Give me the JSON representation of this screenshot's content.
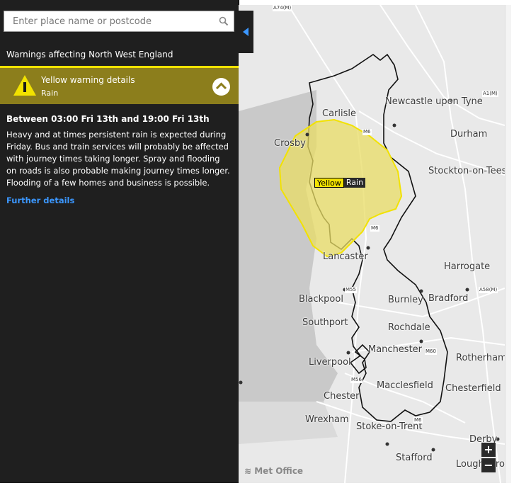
{
  "search": {
    "placeholder": "Enter place name or postcode",
    "icon": "search-icon"
  },
  "region_title": "Warnings affecting North West England",
  "warning": {
    "title": "Yellow warning details",
    "type": "Rain",
    "period": "Between 03:00 Fri 13th and 19:00 Fri 13th",
    "description": "Heavy and at times persistent rain is expected during Friday. Bus and train services will probably be affected with journey times taking longer. Spray and flooding on roads is also probable making journey times longer. Flooding of a few homes and business is possible.",
    "link": "Further details",
    "level": "Yellow"
  },
  "map": {
    "places": [
      "Carlisle",
      "Newcastle upon Tyne",
      "Durham",
      "Crosby",
      "Stockton-on-Tees",
      "Harrogate",
      "Lancaster",
      "Blackpool",
      "Burnley",
      "Bradford",
      "Southport",
      "Rochdale",
      "Manchester",
      "Rotherham",
      "Liverpool",
      "Chester",
      "Macclesfield",
      "Chesterfield",
      "Wrexham",
      "Stoke-on-Trent",
      "Derby",
      "Stafford",
      "Loughborough"
    ],
    "roads": [
      "A74(M)",
      "A1(M)",
      "M6",
      "M6",
      "M55",
      "A58(M)",
      "M60",
      "M56",
      "M6"
    ],
    "zoom_in": "+",
    "zoom_out": "−",
    "logo": "Met Office"
  },
  "colors": {
    "yellow": "#f2e200",
    "panel": "#1f1f1f",
    "link": "#3b97ff",
    "header": "#8c7e1c"
  }
}
